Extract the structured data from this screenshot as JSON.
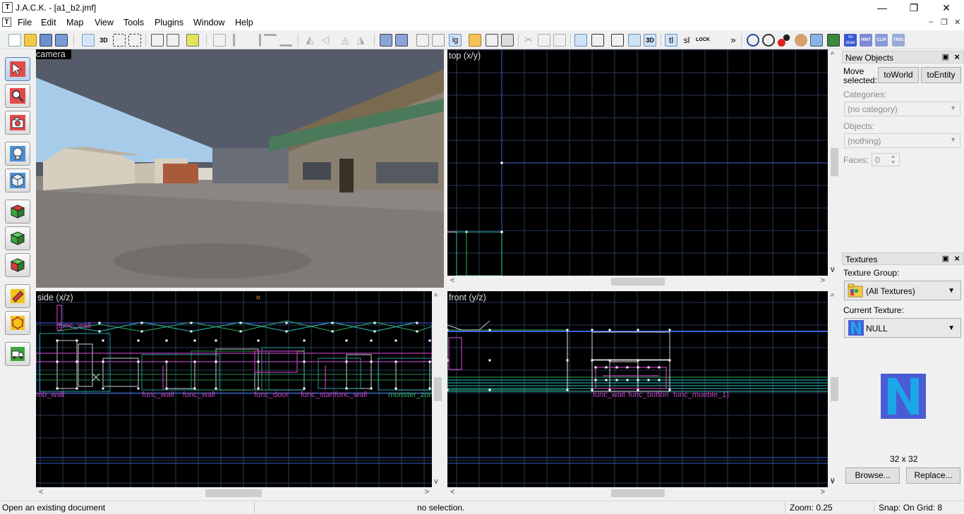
{
  "window": {
    "title": "J.A.C.K. - [a1_b2.jmf]",
    "controls": [
      "—",
      "❐",
      "✕"
    ]
  },
  "menu": {
    "items": [
      "File",
      "Edit",
      "Map",
      "View",
      "Tools",
      "Plugins",
      "Window",
      "Help"
    ],
    "mdi_controls": [
      "–",
      "❐",
      "✕"
    ]
  },
  "toolbar": {
    "text_buttons": {
      "ig": "ig",
      "tl": "tl",
      "sl": "sl",
      "lock": "LOCK",
      "nodraw": "no draw",
      "hint": "HINT",
      "clip": "CLIP",
      "trig": "TRIG",
      "more": "»",
      "d3": "3D"
    }
  },
  "viewports": {
    "camera": {
      "label": "camera"
    },
    "top": {
      "label": "top (x/y)"
    },
    "side": {
      "label": "side (x/z)",
      "entity_labels": [
        "func_wall",
        "mb_wall",
        "func_wall",
        "func_wall",
        "func_door",
        "func_startfunc_wall",
        "monster_zom"
      ],
      "marker": "x"
    },
    "front": {
      "label": "front (y/z)",
      "entity_labels": [
        "func_wall",
        "func_button",
        "func_mueble_1)"
      ]
    }
  },
  "new_objects": {
    "title": "New Objects",
    "move_selected_label": "Move selected:",
    "to_world": "toWorld",
    "to_entity": "toEntity",
    "categories_label": "Categories:",
    "categories_value": "(no category)",
    "objects_label": "Objects:",
    "objects_value": "(nothing)",
    "faces_label": "Faces:",
    "faces_value": "0"
  },
  "textures": {
    "title": "Textures",
    "group_label": "Texture Group:",
    "group_value": "(All Textures)",
    "current_label": "Current Texture:",
    "current_value": "NULL",
    "preview_letter": "N",
    "size": "32 x 32",
    "browse": "Browse...",
    "replace": "Replace..."
  },
  "status": {
    "hint": "Open an existing document",
    "selection": "no selection.",
    "zoom": "Zoom: 0.25",
    "snap": "Snap: On Grid: 8"
  },
  "colors": {
    "grid": "#2a3a52",
    "axis": "#3a5fd0",
    "entity": "#c040c0",
    "brush_cyan": "#30c0c0",
    "brush_white": "#ffffff",
    "brush_green": "#30b060",
    "brush_blue": "#4060e0",
    "texture_blue": "#4a5bd6",
    "texture_cyan": "#1aa6e8"
  }
}
